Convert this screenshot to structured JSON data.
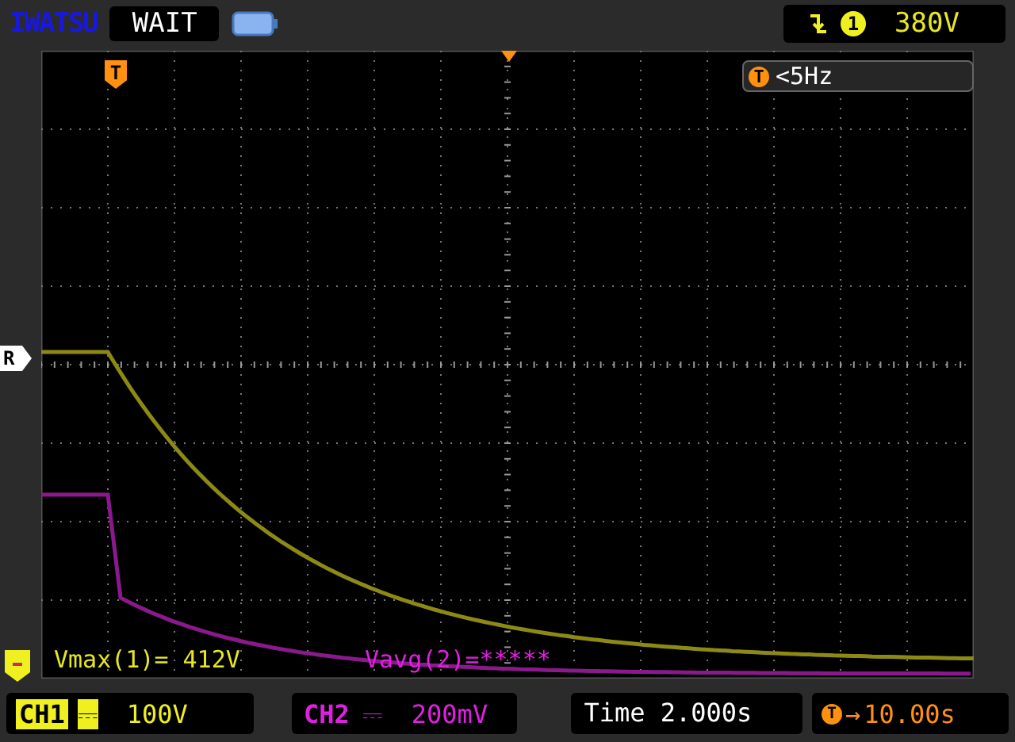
{
  "brand": "IWATSU",
  "status": "WAIT",
  "trigger": {
    "source": "1",
    "level": "380V"
  },
  "trigger_marker": "T",
  "frequency": {
    "marker": "T",
    "value": "<5Hz"
  },
  "level_marker": "R",
  "measurements": [
    {
      "text": "Vmax(1)= 412V",
      "color": "#e8e820"
    },
    {
      "text": "Vavg(2)=*****",
      "color": "#e020e0"
    }
  ],
  "channels": [
    {
      "label": "CH1",
      "coupling": "⎓",
      "scale": "100V",
      "selected": true,
      "color": "#f0f020"
    },
    {
      "label": "CH2",
      "coupling": "⎓",
      "scale": "200mV",
      "selected": false,
      "color": "#e020e0"
    }
  ],
  "timebase": "Time 2.000s",
  "trigger_position": {
    "marker": "T",
    "arrow": "→",
    "value": "10.00s"
  }
}
